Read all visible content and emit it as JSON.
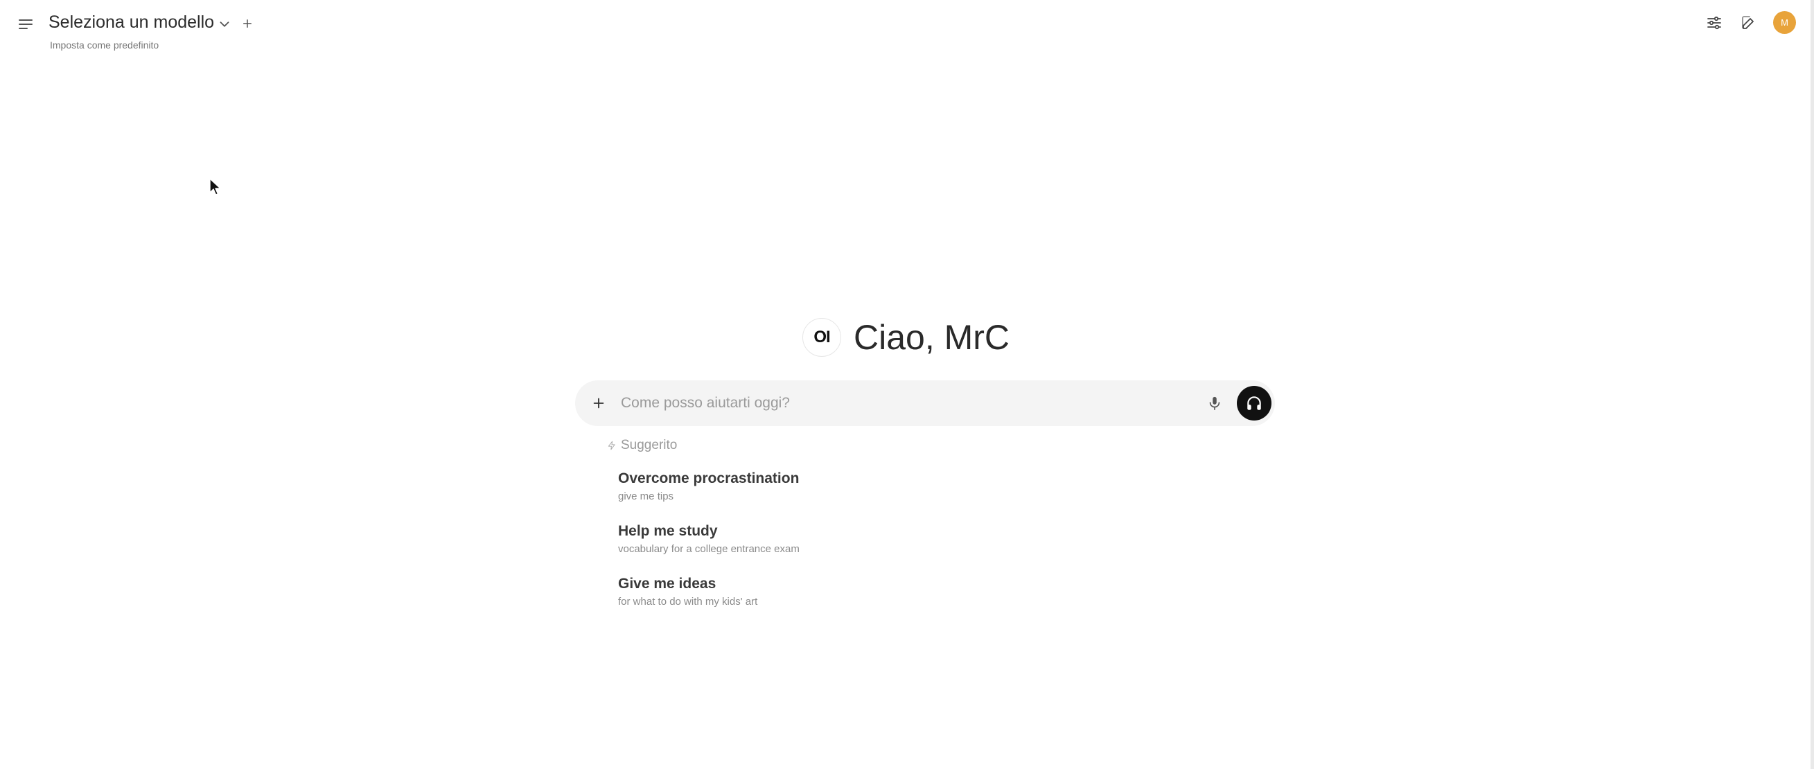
{
  "header": {
    "model_title": "Seleziona un modello",
    "set_default_label": "Imposta come predefinito"
  },
  "user": {
    "avatar_initial": "M",
    "avatar_color": "#e8a33a"
  },
  "greeting": {
    "logo_text": "OI",
    "text": "Ciao, MrC"
  },
  "chat_input": {
    "value": "",
    "placeholder": "Come posso aiutarti oggi?"
  },
  "suggestions": {
    "header": "Suggerito",
    "items": [
      {
        "title": "Overcome procrastination",
        "subtitle": "give me tips"
      },
      {
        "title": "Help me study",
        "subtitle": "vocabulary for a college entrance exam"
      },
      {
        "title": "Give me ideas",
        "subtitle": "for what to do with my kids' art"
      }
    ]
  },
  "icons": {
    "menu": "menu-icon",
    "chevron": "chevron-down-icon",
    "add_model": "plus-icon",
    "controls": "sliders-icon",
    "new_chat": "pencil-icon",
    "attach": "plus-icon",
    "mic": "microphone-icon",
    "voice_mode": "headphones-icon",
    "suggested": "bolt-icon"
  }
}
